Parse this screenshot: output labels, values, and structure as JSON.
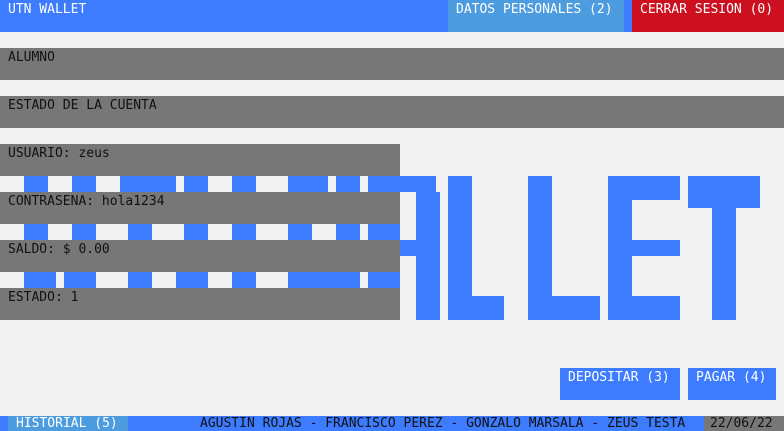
{
  "app": {
    "title": "UTN WALLET"
  },
  "header": {
    "datos_label": "DATOS PERSONALES (2)",
    "cerrar_label": "CERRAR SESION (0)"
  },
  "sections": {
    "alumno": "ALUMNO",
    "estado_cuenta": "ESTADO DE LA CUENTA"
  },
  "account": {
    "usuario": "USUARIO: zeus",
    "contrasena": "CONTRASENA: hola1234",
    "saldo": "SALDO: $ 0.00",
    "estado": "ESTADO: 1"
  },
  "actions": {
    "depositar_label": "DEPOSITAR (3)",
    "pagar_label": "PAGAR (4)",
    "historial_label": "HISTORIAL (5)"
  },
  "footer": {
    "authors": "AGUSTIN ROJAS - FRANCISCO PEREZ - GONZALO MARSALA - ZEUS TESTA",
    "date": "22/06/22"
  },
  "colors": {
    "accent": "#3d7bff",
    "secondary": "#4c9cdf",
    "danger": "#cc1020",
    "panel": "#777777",
    "background": "#f2f2f2"
  }
}
